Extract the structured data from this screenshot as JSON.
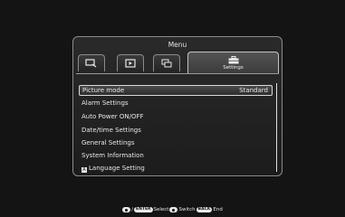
{
  "menu": {
    "title": "Menu",
    "tabs": [
      {
        "icon": "slideshow-icon"
      },
      {
        "icon": "playback-icon"
      },
      {
        "icon": "copy-icon"
      },
      {
        "icon": "toolbox-icon",
        "label": "Settings",
        "active": true
      }
    ],
    "items": [
      {
        "label": "Picture mode",
        "value": "Standard",
        "selected": true
      },
      {
        "label": "Alarm Settings"
      },
      {
        "label": "Auto Power ON/OFF"
      },
      {
        "label": "Date/time Settings"
      },
      {
        "label": "General Settings"
      },
      {
        "label": "System Information"
      },
      {
        "label": "Language Setting",
        "badge": "A"
      }
    ]
  },
  "footer": {
    "enter_key": "ENTER",
    "select_text": "Select",
    "switch_text": "Switch",
    "back_key": "BACK",
    "end_text": "End",
    "separator": "/"
  }
}
